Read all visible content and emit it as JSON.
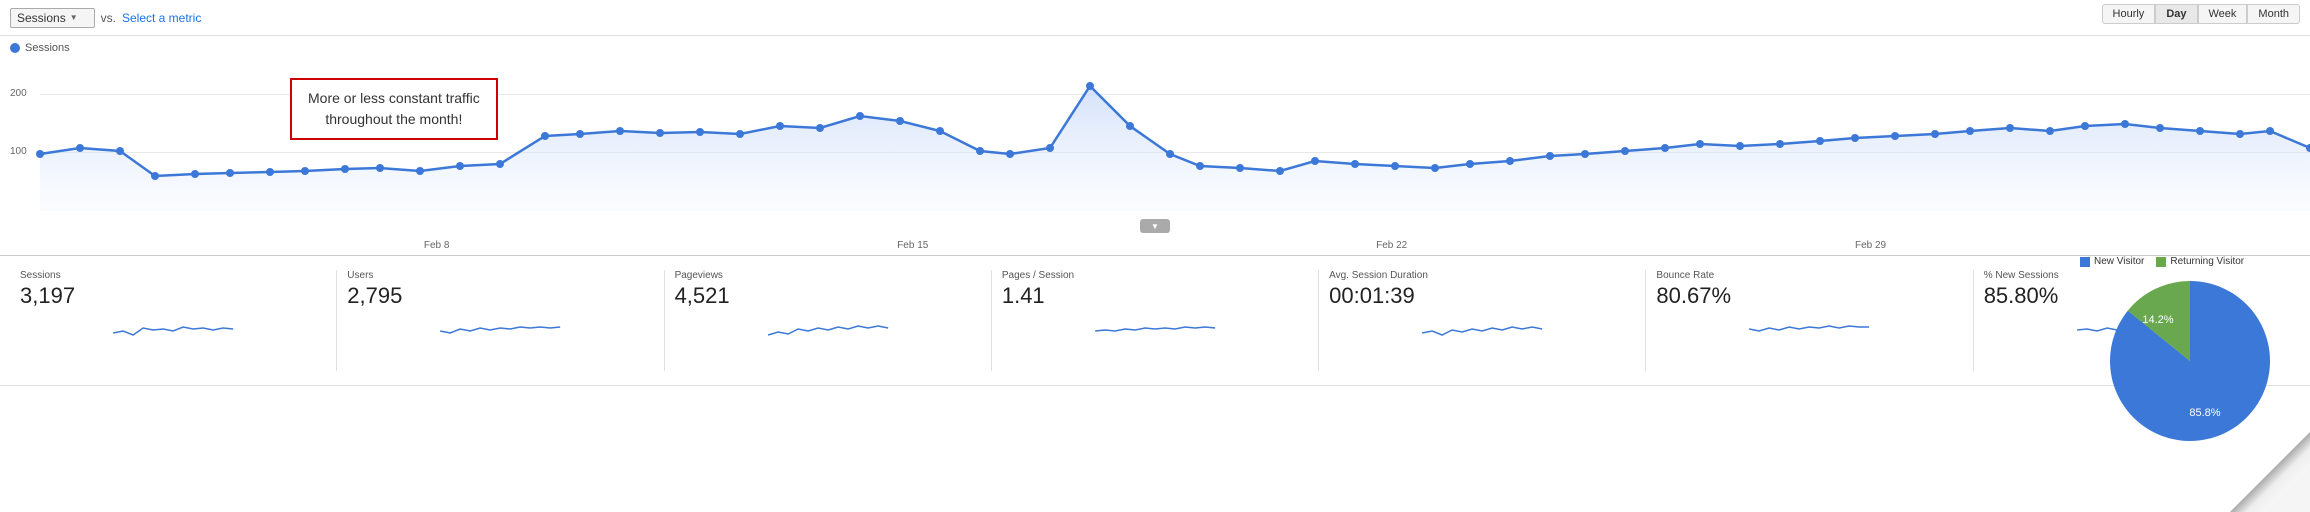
{
  "topbar": {
    "metric_label": "Sessions",
    "vs_label": "vs.",
    "select_metric_text": "Select a metric",
    "time_buttons": [
      "Hourly",
      "Day",
      "Week",
      "Month"
    ],
    "active_time_button": "Day"
  },
  "annotation": {
    "line1": "More or less constant traffic",
    "line2": "throughout the month!"
  },
  "chart": {
    "legend_label": "Sessions",
    "y_labels": [
      "200",
      "100"
    ],
    "x_labels": [
      "Feb 8",
      "Feb 15",
      "Feb 22",
      "Feb 29"
    ]
  },
  "stats": [
    {
      "label": "Sessions",
      "value": "3,197"
    },
    {
      "label": "Users",
      "value": "2,795"
    },
    {
      "label": "Pageviews",
      "value": "4,521"
    },
    {
      "label": "Pages / Session",
      "value": "1.41"
    },
    {
      "label": "Avg. Session Duration",
      "value": "00:01:39"
    },
    {
      "label": "Bounce Rate",
      "value": "80.67%"
    },
    {
      "label": "% New Sessions",
      "value": "85.80%"
    }
  ],
  "pie": {
    "legend": [
      {
        "label": "New Visitor",
        "color": "#3c78d8"
      },
      {
        "label": "Returning Visitor",
        "color": "#6aa84f"
      }
    ],
    "slices": [
      {
        "label": "85.8%",
        "value": 85.8,
        "color": "#3c78d8"
      },
      {
        "label": "14.2%",
        "value": 14.2,
        "color": "#6aa84f"
      }
    ]
  }
}
